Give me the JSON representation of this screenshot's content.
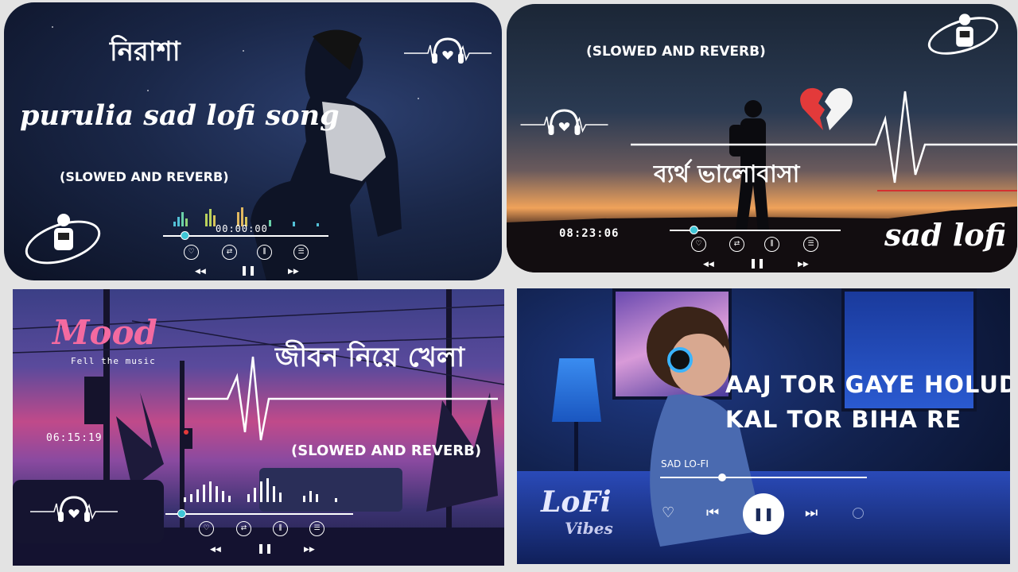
{
  "panel1": {
    "title_bn": "নিরাশা",
    "subtitle": "purulia sad lofi song",
    "tag": "(SLOWED AND REVERB)",
    "timer": "00:00:00"
  },
  "panel2": {
    "tag": "(SLOWED AND REVERB)",
    "title_bn": "ব্যর্থ ভালোবাসা",
    "timer": "08:23:06",
    "subtitle": "sad lofi"
  },
  "panel3": {
    "brand": "Mood",
    "brand_sub": "Fell the music",
    "title_bn": "জীবন নিয়ে খেলা",
    "tag": "(SLOWED AND REVERB)",
    "timer": "06:15:19"
  },
  "panel4": {
    "line1": "AAJ TOR GAYE HOLUD",
    "line2": "KAL TOR BIHA RE",
    "track": "SAD LO-FI",
    "logo_top": "LoFi",
    "logo_bottom": "Vibes"
  },
  "icons": {
    "prev": "◀◀",
    "next": "▶▶",
    "pause": "❚❚",
    "heart": "♡",
    "repeat": "⇄",
    "equalizer": "⫼",
    "list": "☰",
    "skip_back": "⏮",
    "skip_fwd": "⏭"
  }
}
